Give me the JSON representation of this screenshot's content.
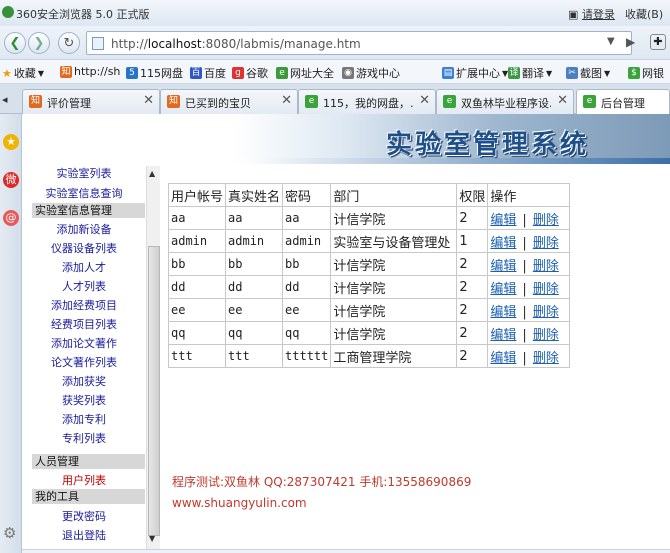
{
  "window": {
    "title": "360安全浏览器 5.0 正式版",
    "login": "请登录",
    "favorites": "收藏(B)"
  },
  "address": {
    "prefix": "http://",
    "host": "localhost",
    "rest": ":8080/labmis/manage.htm"
  },
  "bookmarks": [
    "收藏",
    "http://sh",
    "115网盘",
    "百度",
    "谷歌",
    "网址大全",
    "游戏中心",
    "扩展中心",
    "翻译",
    "截图",
    "网银"
  ],
  "tabs": [
    {
      "label": "评价管理",
      "active": false
    },
    {
      "label": "已买到的宝贝",
      "active": false
    },
    {
      "label": "115，我的网盘，...",
      "active": false
    },
    {
      "label": "双鱼林毕业程序设...",
      "active": false
    },
    {
      "label": "后台管理",
      "active": true
    }
  ],
  "banner": {
    "title": "实验室管理系统"
  },
  "menu": {
    "items_top": [
      "实验室列表",
      "实验室信息查询"
    ],
    "section_lab": "实验室信息管理",
    "items_lab": [
      "添加新设备",
      "仪器设备列表",
      "添加人才",
      "人才列表",
      "添加经费项目",
      "经费项目列表",
      "添加论文著作",
      "论文著作列表",
      "添加获奖",
      "获奖列表",
      "添加专利",
      "专利列表"
    ],
    "section_people": "人员管理",
    "items_people": [
      "用户列表"
    ],
    "section_tools": "我的工具",
    "items_tools": [
      "更改密码",
      "退出登陆"
    ]
  },
  "table": {
    "headers": [
      "用户帐号",
      "真实姓名",
      "密码",
      "部门",
      "权限",
      "操作"
    ],
    "edit_label": "编辑",
    "delete_label": "删除",
    "separator": "|",
    "rows": [
      {
        "account": "aa",
        "name": "aa",
        "password": "aa",
        "dept": "计信学院",
        "perm": "2"
      },
      {
        "account": "admin",
        "name": "admin",
        "password": "admin",
        "dept": "实验室与设备管理处",
        "perm": "1"
      },
      {
        "account": "bb",
        "name": "bb",
        "password": "bb",
        "dept": "计信学院",
        "perm": "2"
      },
      {
        "account": "dd",
        "name": "dd",
        "password": "dd",
        "dept": "计信学院",
        "perm": "2"
      },
      {
        "account": "ee",
        "name": "ee",
        "password": "ee",
        "dept": "计信学院",
        "perm": "2"
      },
      {
        "account": "qq",
        "name": "qq",
        "password": "qq",
        "dept": "计信学院",
        "perm": "2"
      },
      {
        "account": "ttt",
        "name": "ttt",
        "password": "tttttt",
        "dept": "工商管理学院",
        "perm": "2"
      }
    ]
  },
  "footer": {
    "line1": "程序测试:双鱼林 QQ:287307421 手机:13558690869",
    "line2": "www.shuangyulin.com"
  }
}
